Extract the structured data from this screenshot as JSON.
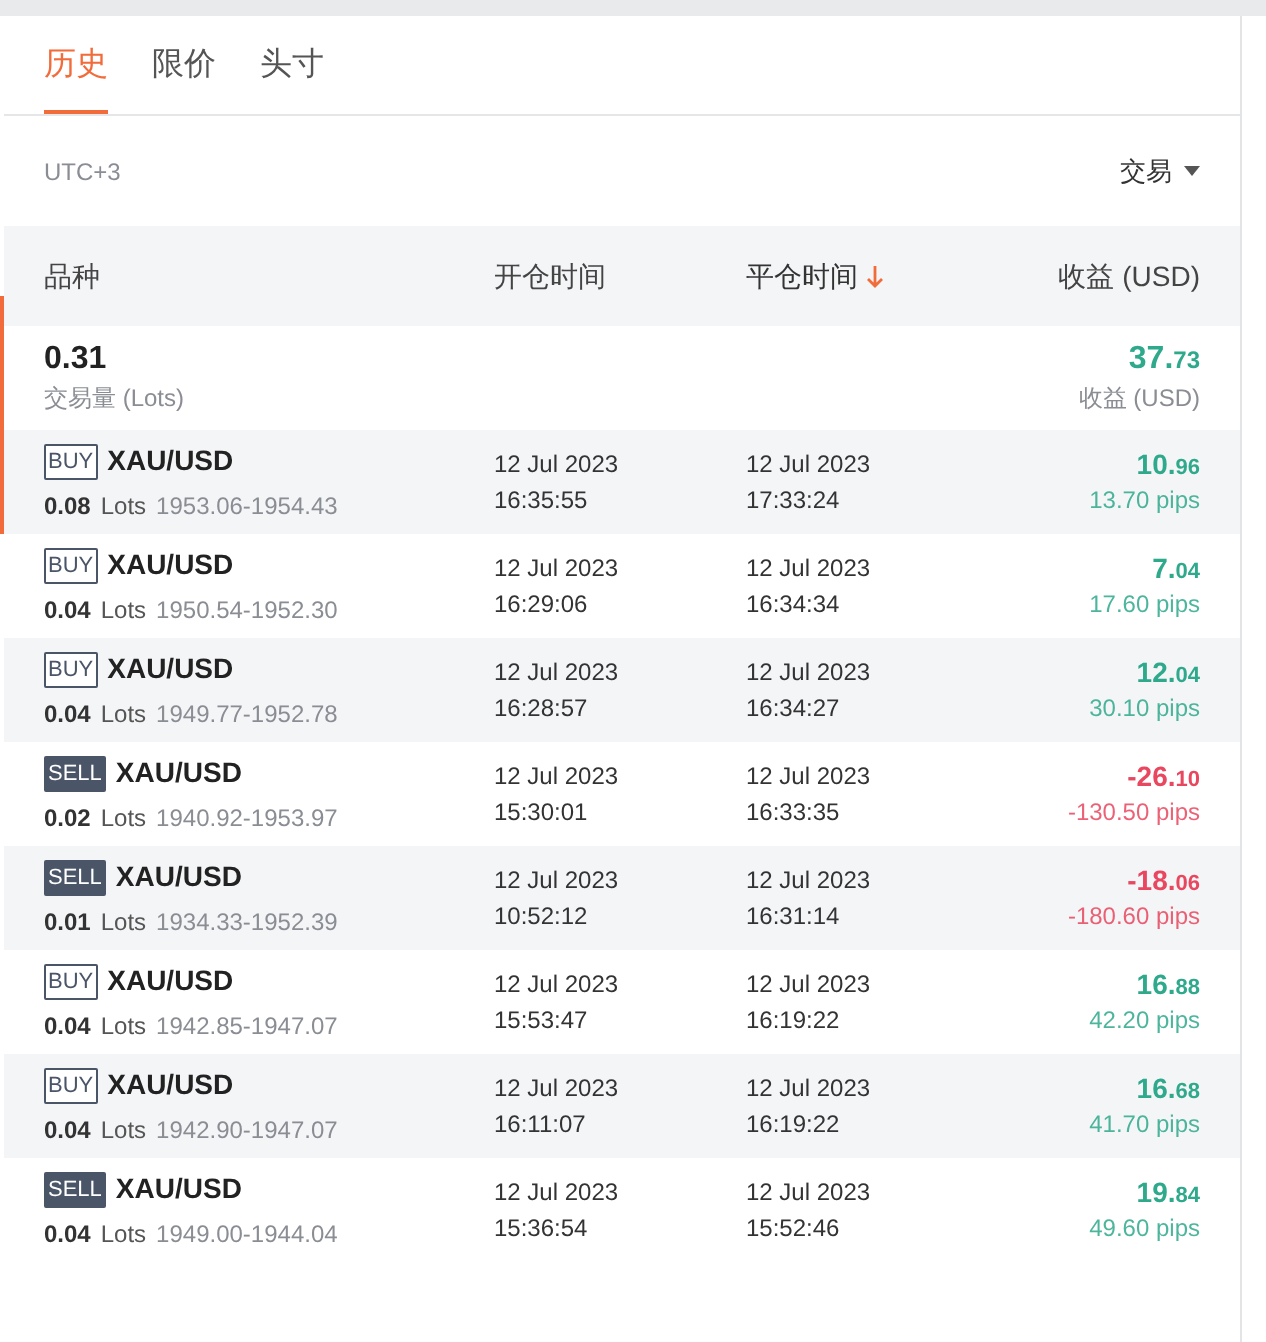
{
  "tabs": [
    {
      "label": "历史",
      "selected": true
    },
    {
      "label": "限价",
      "selected": false
    },
    {
      "label": "头寸",
      "selected": false
    }
  ],
  "timezone": "UTC+3",
  "filter": {
    "label": "交易"
  },
  "columns": [
    {
      "label": "品种",
      "sorted": false
    },
    {
      "label": "开仓时间",
      "sorted": false
    },
    {
      "label": "平仓时间",
      "sorted": true
    },
    {
      "label": "收益 (USD)",
      "sorted": false
    }
  ],
  "summary": {
    "volume": "0.31",
    "volume_label": "交易量 (Lots)",
    "profit_main": "37.",
    "profit_decimals": "73",
    "profit_label": "收益 (USD)"
  },
  "trades": [
    {
      "side": "BUY",
      "kind": "buy",
      "symbol": "XAU/USD",
      "lots": "0.08",
      "lots_label": "Lots",
      "prices": "1953.06-1954.43",
      "open_date": "12 Jul 2023",
      "open_time": "16:35:55",
      "close_date": "12 Jul 2023",
      "close_time": "17:33:24",
      "profit_main": "10.",
      "profit_decimals": "96",
      "pips": "13.70 pips",
      "color": "#2fa98c"
    },
    {
      "side": "BUY",
      "kind": "buy",
      "symbol": "XAU/USD",
      "lots": "0.04",
      "lots_label": "Lots",
      "prices": "1950.54-1952.30",
      "open_date": "12 Jul 2023",
      "open_time": "16:29:06",
      "close_date": "12 Jul 2023",
      "close_time": "16:34:34",
      "profit_main": "7.",
      "profit_decimals": "04",
      "pips": "17.60 pips",
      "color": "#2fa98c"
    },
    {
      "side": "BUY",
      "kind": "buy",
      "symbol": "XAU/USD",
      "lots": "0.04",
      "lots_label": "Lots",
      "prices": "1949.77-1952.78",
      "open_date": "12 Jul 2023",
      "open_time": "16:28:57",
      "close_date": "12 Jul 2023",
      "close_time": "16:34:27",
      "profit_main": "12.",
      "profit_decimals": "04",
      "pips": "30.10 pips",
      "color": "#2fa98c"
    },
    {
      "side": "SELL",
      "kind": "sell",
      "symbol": "XAU/USD",
      "lots": "0.02",
      "lots_label": "Lots",
      "prices": "1940.92-1953.97",
      "open_date": "12 Jul 2023",
      "open_time": "15:30:01",
      "close_date": "12 Jul 2023",
      "close_time": "16:33:35",
      "profit_main": "-26.",
      "profit_decimals": "10",
      "pips": "-130.50 pips",
      "color": "#e8475f"
    },
    {
      "side": "SELL",
      "kind": "sell",
      "symbol": "XAU/USD",
      "lots": "0.01",
      "lots_label": "Lots",
      "prices": "1934.33-1952.39",
      "open_date": "12 Jul 2023",
      "open_time": "10:52:12",
      "close_date": "12 Jul 2023",
      "close_time": "16:31:14",
      "profit_main": "-18.",
      "profit_decimals": "06",
      "pips": "-180.60 pips",
      "color": "#e8475f"
    },
    {
      "side": "BUY",
      "kind": "buy",
      "symbol": "XAU/USD",
      "lots": "0.04",
      "lots_label": "Lots",
      "prices": "1942.85-1947.07",
      "open_date": "12 Jul 2023",
      "open_time": "15:53:47",
      "close_date": "12 Jul 2023",
      "close_time": "16:19:22",
      "profit_main": "16.",
      "profit_decimals": "88",
      "pips": "42.20 pips",
      "color": "#2fa98c"
    },
    {
      "side": "BUY",
      "kind": "buy",
      "symbol": "XAU/USD",
      "lots": "0.04",
      "lots_label": "Lots",
      "prices": "1942.90-1947.07",
      "open_date": "12 Jul 2023",
      "open_time": "16:11:07",
      "close_date": "12 Jul 2023",
      "close_time": "16:19:22",
      "profit_main": "16.",
      "profit_decimals": "68",
      "pips": "41.70 pips",
      "color": "#2fa98c"
    },
    {
      "side": "SELL",
      "kind": "sell",
      "symbol": "XAU/USD",
      "lots": "0.04",
      "lots_label": "Lots",
      "prices": "1949.00-1944.04",
      "open_date": "12 Jul 2023",
      "open_time": "15:36:54",
      "close_date": "12 Jul 2023",
      "close_time": "15:52:46",
      "profit_main": "19.",
      "profit_decimals": "84",
      "pips": "49.60 pips",
      "color": "#2fa98c"
    }
  ]
}
